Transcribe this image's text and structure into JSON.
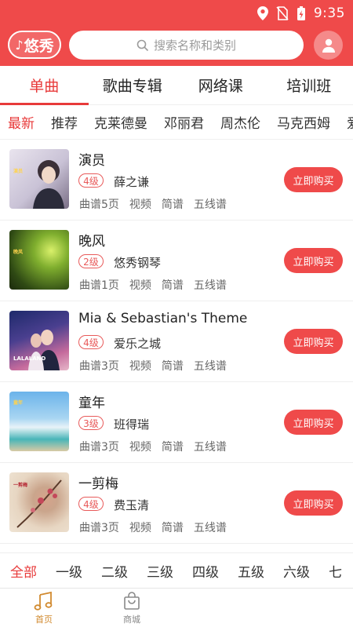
{
  "status_bar": {
    "time": "9:35",
    "icons": [
      "location-icon",
      "no-sim-icon",
      "battery-charging-icon"
    ]
  },
  "header": {
    "logo_text": "悠秀",
    "search_placeholder": "搜索名称和类别",
    "search_icon": "search-icon",
    "profile_icon": "user-icon",
    "accent_color": "#ef4a4a"
  },
  "main_tabs": [
    {
      "label": "单曲",
      "active": true
    },
    {
      "label": "歌曲专辑",
      "active": false
    },
    {
      "label": "网络课",
      "active": false
    },
    {
      "label": "培训班",
      "active": false
    }
  ],
  "artist_filters": [
    "最新",
    "推荐",
    "克莱德曼",
    "邓丽君",
    "周杰伦",
    "马克西姆",
    "爱"
  ],
  "songs": [
    {
      "title": "演员",
      "level": "4级",
      "artist": "薛之谦",
      "tags": [
        "曲谱5页",
        "视频",
        "简谱",
        "五线谱"
      ],
      "buy_label": "立即购买",
      "cover_caption": "演员"
    },
    {
      "title": "晚风",
      "level": "2级",
      "artist": "悠秀钢琴",
      "tags": [
        "曲谱1页",
        "视频",
        "简谱",
        "五线谱"
      ],
      "buy_label": "立即购买",
      "cover_caption": "晚风"
    },
    {
      "title": "Mia & Sebastian's Theme",
      "level": "4级",
      "artist": "爱乐之城",
      "tags": [
        "曲谱3页",
        "视频",
        "简谱",
        "五线谱"
      ],
      "buy_label": "立即购买",
      "cover_caption": "LALALAND"
    },
    {
      "title": "童年",
      "level": "3级",
      "artist": "班得瑞",
      "tags": [
        "曲谱3页",
        "视频",
        "简谱",
        "五线谱"
      ],
      "buy_label": "立即购买",
      "cover_caption": "童年"
    },
    {
      "title": "一剪梅",
      "level": "4级",
      "artist": "费玉清",
      "tags": [
        "曲谱3页",
        "视频",
        "简谱",
        "五线谱"
      ],
      "buy_label": "立即购买",
      "cover_caption": "一剪梅"
    }
  ],
  "level_filters": [
    "全部",
    "一级",
    "二级",
    "三级",
    "四级",
    "五级",
    "六级",
    "七"
  ],
  "bottom_nav": [
    {
      "label": "首页",
      "icon": "music-note-icon",
      "active": true
    },
    {
      "label": "商城",
      "icon": "shopping-bag-icon",
      "active": false
    }
  ]
}
